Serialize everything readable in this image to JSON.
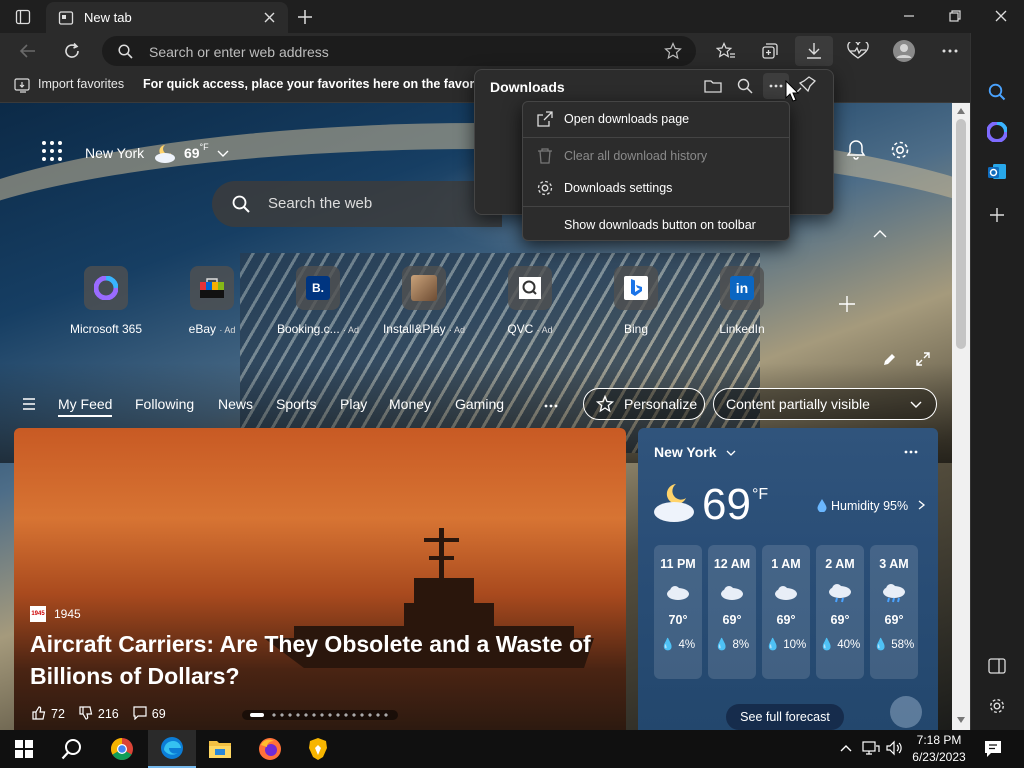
{
  "tab": {
    "title": "New tab"
  },
  "address": {
    "placeholder": "Search or enter web address"
  },
  "favorites": {
    "import_label": "Import favorites",
    "message": "For quick access, place your favorites here on the favorites ba"
  },
  "newtab": {
    "location": "New York",
    "temp_short": "69",
    "unit_short": "°F",
    "search_placeholder": "Search the web",
    "quick_links": [
      {
        "label": "Microsoft 365",
        "ad": ""
      },
      {
        "label": "eBay",
        "ad": "· Ad"
      },
      {
        "label": "Booking.c...",
        "ad": "· Ad"
      },
      {
        "label": "Install&Play",
        "ad": "· Ad"
      },
      {
        "label": "QVC",
        "ad": "· Ad"
      },
      {
        "label": "Bing",
        "ad": ""
      },
      {
        "label": "LinkedIn",
        "ad": ""
      }
    ],
    "feed_tabs": [
      "My Feed",
      "Following",
      "News",
      "Sports",
      "Play",
      "Money",
      "Gaming"
    ],
    "personalize": "Personalize",
    "content_visibility": "Content partially visible"
  },
  "news_card": {
    "source": "1945",
    "source_logo": "1945",
    "headline": "Aircraft Carriers: Are They Obsolete and a Waste of Billions of Dollars?",
    "likes": "72",
    "dislikes": "216",
    "comments": "69"
  },
  "weather_card": {
    "city": "New York",
    "temp": "69",
    "unit": "°F",
    "humidity": "Humidity 95%",
    "hours": [
      {
        "time": "11 PM",
        "temp": "70°",
        "precip": "4%"
      },
      {
        "time": "12 AM",
        "temp": "69°",
        "precip": "8%"
      },
      {
        "time": "1 AM",
        "temp": "69°",
        "precip": "10%"
      },
      {
        "time": "2 AM",
        "temp": "69°",
        "precip": "40%"
      },
      {
        "time": "3 AM",
        "temp": "69°",
        "precip": "58%"
      }
    ],
    "forecast_btn": "See full forecast"
  },
  "downloads": {
    "title": "Downloads",
    "menu": {
      "open_page": "Open downloads page",
      "clear_history": "Clear all download history",
      "settings": "Downloads settings",
      "show_button": "Show downloads button on toolbar"
    }
  },
  "taskbar": {
    "time": "7:18 PM",
    "date": "6/23/2023"
  },
  "colors": {
    "accent": "#3a7bd5",
    "frame": "#1f1f1f",
    "toolbar": "#2b2b2b"
  }
}
